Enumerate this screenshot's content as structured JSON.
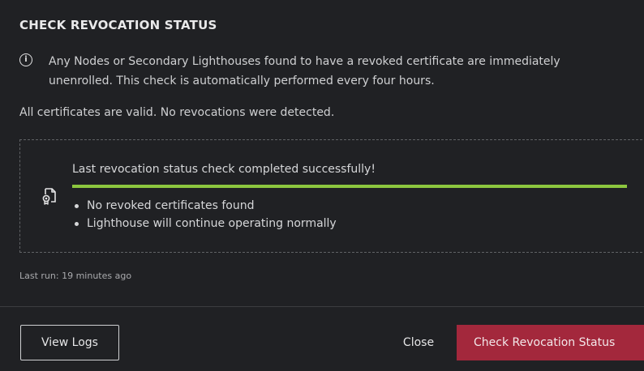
{
  "dialog": {
    "title": "CHECK REVOCATION STATUS",
    "info": {
      "icon": "info-icon",
      "line1": "Any Nodes or Secondary Lighthouses found to have a revoked certificate are immediately",
      "line2": "unenrolled. This check is automatically performed every four hours."
    },
    "status_text": "All certificates are valid. No revocations were detected.",
    "result": {
      "icon": "certificate-icon",
      "heading": "Last revocation status check completed successfully!",
      "progress_percent": 100,
      "progress_color": "#8cc63f",
      "bullets": [
        "No revoked certificates found",
        "Lighthouse will continue operating normally"
      ]
    },
    "last_run": "Last run: 19 minutes ago"
  },
  "footer": {
    "view_logs_label": "View Logs",
    "close_label": "Close",
    "check_label": "Check Revocation Status",
    "primary_color": "#a3283c"
  }
}
